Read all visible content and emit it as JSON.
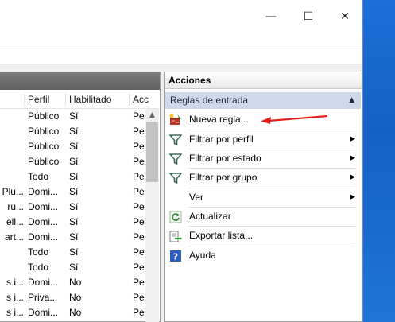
{
  "window": {
    "controls": {
      "minimize": "—",
      "maximize": "☐",
      "close": "✕"
    }
  },
  "table": {
    "columns": [
      "Perfil",
      "Habilitado",
      "Acc"
    ],
    "rows": [
      {
        "name": "",
        "profile": "Público",
        "enabled": "Sí",
        "action": "Per"
      },
      {
        "name": "",
        "profile": "Público",
        "enabled": "Sí",
        "action": "Per"
      },
      {
        "name": "",
        "profile": "Público",
        "enabled": "Sí",
        "action": "Per"
      },
      {
        "name": "",
        "profile": "Público",
        "enabled": "Sí",
        "action": "Per"
      },
      {
        "name": "",
        "profile": "Todo",
        "enabled": "Sí",
        "action": "Per"
      },
      {
        "name": "Plu...",
        "profile": "Domi...",
        "enabled": "Sí",
        "action": "Per"
      },
      {
        "name": "ru...",
        "profile": "Domi...",
        "enabled": "Sí",
        "action": "Per"
      },
      {
        "name": "ell...",
        "profile": "Domi...",
        "enabled": "Sí",
        "action": "Per"
      },
      {
        "name": "art...",
        "profile": "Domi...",
        "enabled": "Sí",
        "action": "Per"
      },
      {
        "name": "",
        "profile": "Todo",
        "enabled": "Sí",
        "action": "Per"
      },
      {
        "name": "",
        "profile": "Todo",
        "enabled": "Sí",
        "action": "Per"
      },
      {
        "name": "s i...",
        "profile": "Domi...",
        "enabled": "No",
        "action": "Per"
      },
      {
        "name": "s i...",
        "profile": "Priva...",
        "enabled": "No",
        "action": "Per"
      },
      {
        "name": "s i...",
        "profile": "Domi...",
        "enabled": "No",
        "action": "Per"
      }
    ]
  },
  "actions": {
    "title": "Acciones",
    "section": "Reglas de entrada",
    "collapse_glyph": "▲",
    "submenu_glyph": "▶",
    "items": [
      {
        "label": "Nueva regla...",
        "icon": "new-rule-icon"
      },
      {
        "label": "Filtrar por perfil",
        "icon": "filter-icon"
      },
      {
        "label": "Filtrar por estado",
        "icon": "filter-icon"
      },
      {
        "label": "Filtrar por grupo",
        "icon": "filter-icon"
      },
      {
        "label": "Ver",
        "icon": ""
      },
      {
        "label": "Actualizar",
        "icon": "refresh-icon"
      },
      {
        "label": "Exportar lista...",
        "icon": "export-icon"
      },
      {
        "label": "Ayuda",
        "icon": "help-icon"
      }
    ]
  },
  "colors": {
    "annotation_arrow": "#e0201c",
    "section_header": "#cdd9ea",
    "desktop": "#1a66c9"
  }
}
